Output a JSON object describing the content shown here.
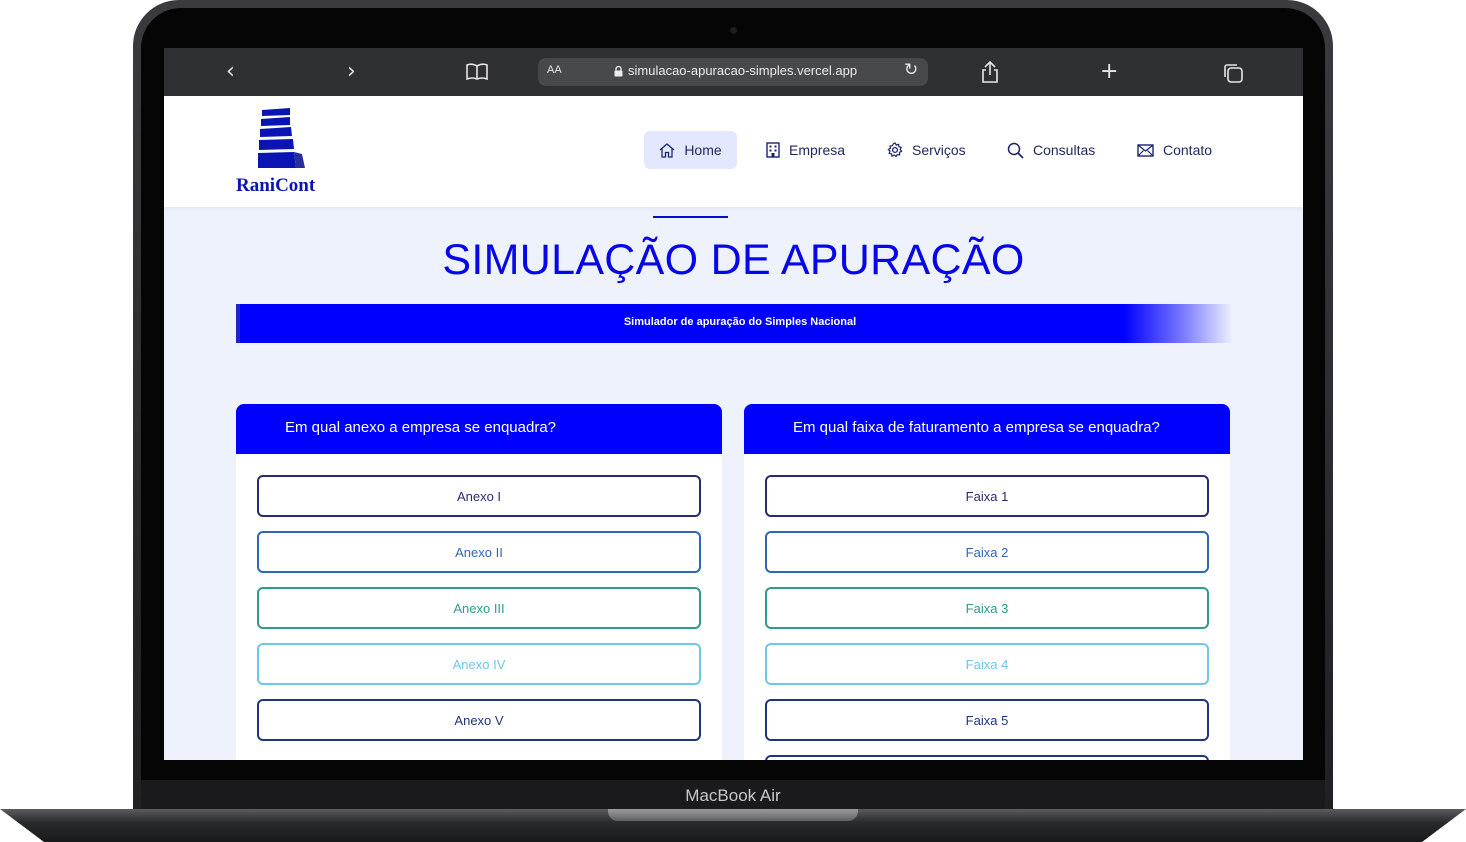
{
  "device": {
    "label": "MacBook Air"
  },
  "browser": {
    "reader_label": "AA",
    "url": "simulacao-apuracao-simples.vercel.app"
  },
  "header": {
    "logo_text": "RaniCont",
    "nav": [
      {
        "label": "Home",
        "icon": "home-icon"
      },
      {
        "label": "Empresa",
        "icon": "building-icon"
      },
      {
        "label": "Serviços",
        "icon": "gear-icon"
      },
      {
        "label": "Consultas",
        "icon": "search-icon"
      },
      {
        "label": "Contato",
        "icon": "mail-icon"
      }
    ]
  },
  "main": {
    "title": "SIMULAÇÃO DE APURAÇÃO",
    "banner": "Simulador de apuração do Simples Nacional",
    "anexo_card": {
      "title": "Em qual anexo a empresa se enquadra?",
      "options": [
        "Anexo I",
        "Anexo II",
        "Anexo III",
        "Anexo IV",
        "Anexo V"
      ]
    },
    "faixa_card": {
      "title": "Em qual faixa de faturamento a empresa se enquadra?",
      "options": [
        "Faixa 1",
        "Faixa 2",
        "Faixa 3",
        "Faixa 4",
        "Faixa 5"
      ]
    }
  },
  "colors": {
    "accent": "#0000ff",
    "option_border_colors": [
      "#2a2a72",
      "#2f66b5",
      "#2f9a8e",
      "#6fc6ea",
      "#1b3580"
    ]
  }
}
